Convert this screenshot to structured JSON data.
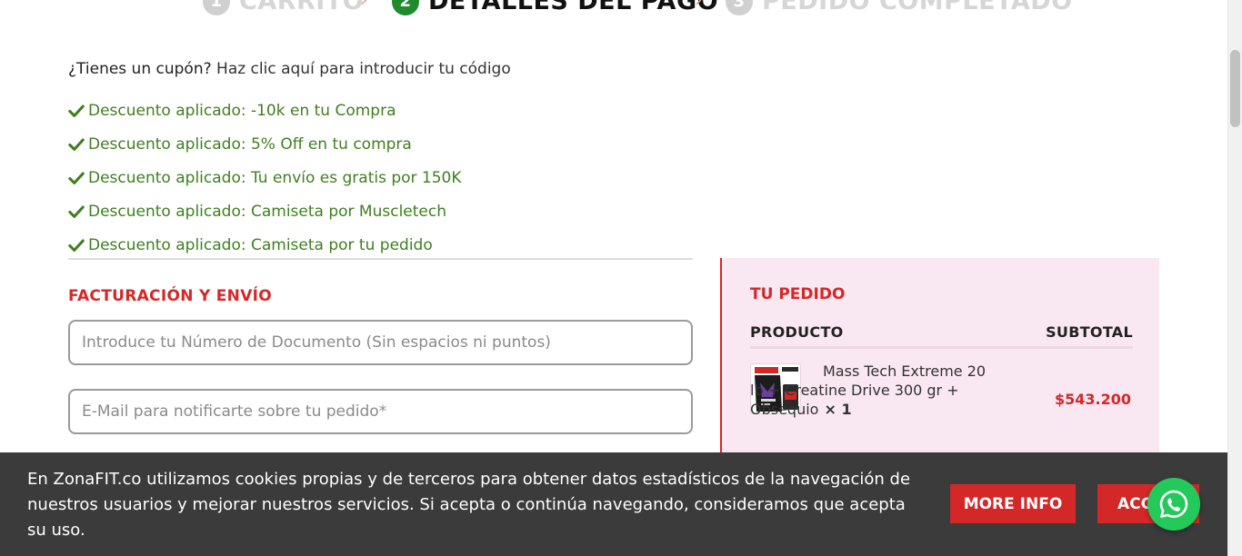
{
  "steps": {
    "step1": {
      "number": "1",
      "label": "CARRITO"
    },
    "step2": {
      "number": "2",
      "label": "DETALLES DEL PAGO"
    },
    "step3": {
      "number": "3",
      "label": "PEDIDO COMPLETADO"
    },
    "separator": "›"
  },
  "coupon": {
    "question": "¿Tienes un cupón?",
    "link": "Haz clic aquí para introducir tu código"
  },
  "notices": [
    "Descuento aplicado: -10k en tu Compra",
    "Descuento aplicado: 5% Off en tu compra",
    "Descuento aplicado: Tu envío es gratis por 150K",
    "Descuento aplicado: Camiseta por Muscletech",
    "Descuento aplicado: Camiseta por tu pedido"
  ],
  "billing": {
    "title": "FACTURACIÓN Y ENVÍO",
    "document_placeholder": "Introduce tu Número de Documento (Sin espacios ni puntos)",
    "email_placeholder": "E-Mail para notificarte sobre tu pedido*"
  },
  "order": {
    "title": "TU PEDIDO",
    "col_product": "PRODUCTO",
    "col_subtotal": "SUBTOTAL",
    "item": {
      "name": "Mass Tech Extreme 20 lb + Creatine Drive 300 gr + Obsequio",
      "qty": "× 1",
      "price": "$543.200",
      "icon": "product-thumbnail"
    }
  },
  "cookie": {
    "text": "En ZonaFIT.co utilizamos cookies propias y de terceros para obtener datos estadísticos de la navegación de nuestros usuarios y mejorar nuestros servicios. Si acepta o continúa navegando, consideramos que acepta su uso.",
    "more_info": "MORE INFO",
    "accept": "ACCEPT"
  },
  "colors": {
    "accent": "#d42828",
    "success": "#3f7f1f",
    "whatsapp": "#24c95c",
    "cookie_bg": "#3b3b3b",
    "order_bg": "#f9e7f1"
  }
}
